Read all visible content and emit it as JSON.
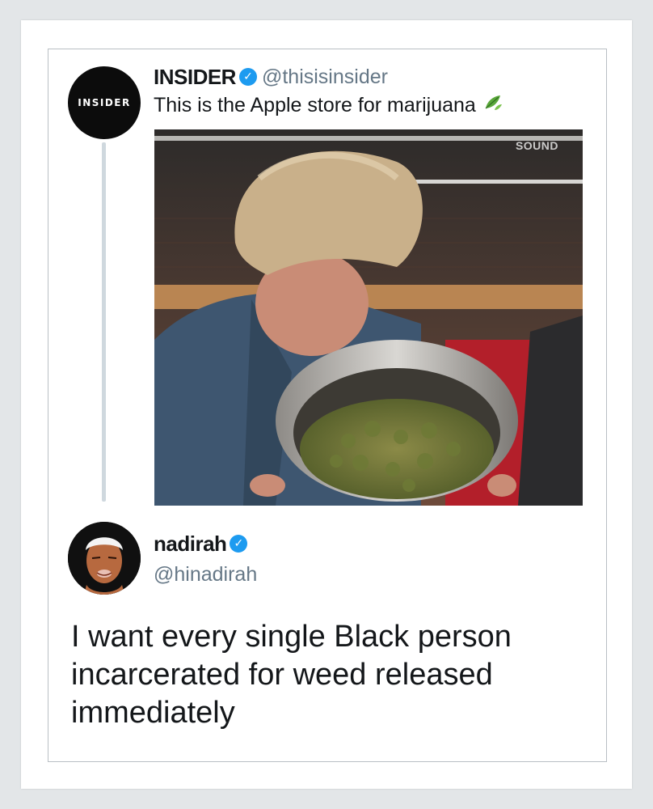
{
  "tweet1": {
    "name": "INSIDER",
    "handle": "@thisisinsider",
    "text": "This is the Apple store for marijuana",
    "avatar_text": "INSIDER",
    "media_watermark": "SOUND",
    "emoji": "leaf-icon"
  },
  "tweet2": {
    "name": "nadirah",
    "handle": "@hinadirah",
    "text": "I want every single Black person incarcerated for weed released immediately"
  },
  "colors": {
    "verified": "#1d9bf0",
    "handle": "#657786",
    "text": "#14171a",
    "thread_line": "#cfd8de"
  }
}
